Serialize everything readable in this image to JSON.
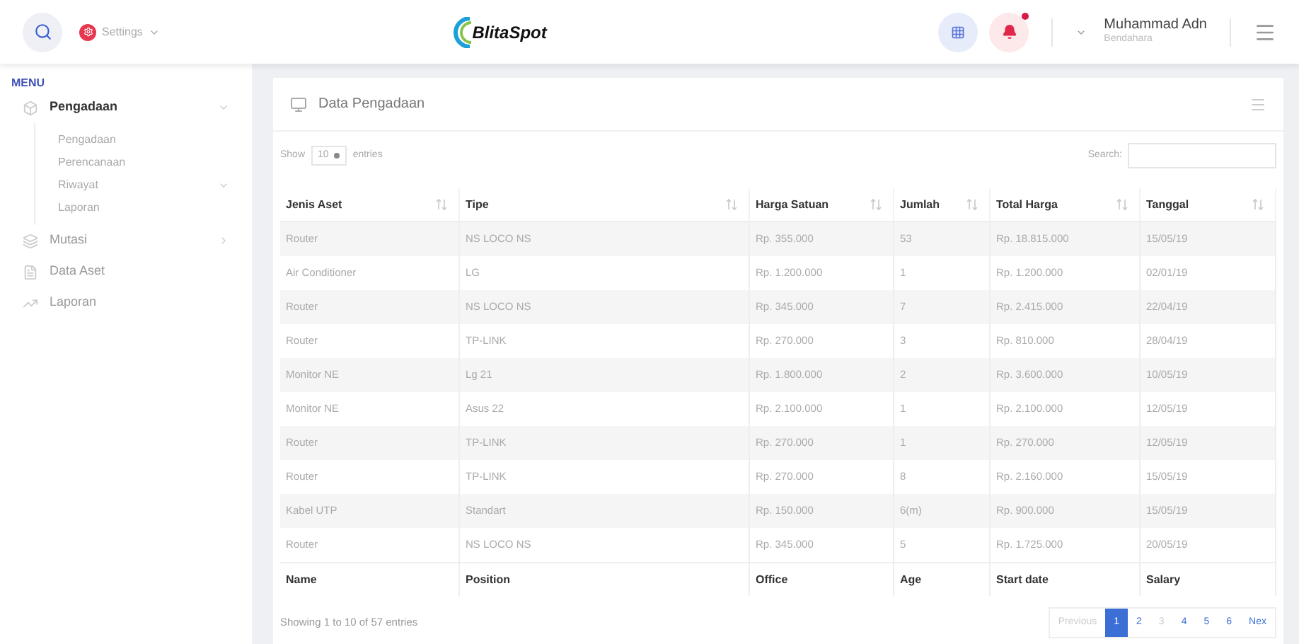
{
  "header": {
    "settings_label": "Settings",
    "logo": "BlitaSpot",
    "user": {
      "name": "Muhammad Adn",
      "role": "Bendahara"
    },
    "notification_dot": true
  },
  "sidebar": {
    "heading": "MENU",
    "items": [
      {
        "label": "Pengadaan",
        "expanded": true,
        "has_chevron": true,
        "children": [
          {
            "label": "Pengadaan",
            "has_chevron": false
          },
          {
            "label": "Perencanaan",
            "has_chevron": false
          },
          {
            "label": "Riwayat",
            "has_chevron": true
          },
          {
            "label": "Laporan",
            "has_chevron": false
          }
        ]
      },
      {
        "label": "Mutasi",
        "expanded": false,
        "has_chevron": true
      },
      {
        "label": "Data Aset",
        "expanded": false,
        "has_chevron": false
      },
      {
        "label": "Laporan",
        "expanded": false,
        "has_chevron": false
      }
    ]
  },
  "card": {
    "title": "Data Pengadaan",
    "show_label": "Show",
    "entries_value": "10",
    "entries_label": "entries",
    "search_label": "Search:",
    "table": {
      "columns": [
        "Jenis Aset",
        "Tipe",
        "Harga Satuan",
        "Jumlah",
        "Total Harga",
        "Tanggal"
      ],
      "rows": [
        [
          "Router",
          "NS LOCO NS",
          "Rp. 355.000",
          "53",
          "Rp. 18.815.000",
          "15/05/19"
        ],
        [
          "Air Conditioner",
          "LG",
          "Rp. 1.200.000",
          "1",
          "Rp. 1.200.000",
          "02/01/19"
        ],
        [
          "Router",
          "NS LOCO NS",
          "Rp. 345.000",
          "7",
          "Rp. 2.415.000",
          "22/04/19"
        ],
        [
          "Router",
          "TP-LINK",
          "Rp. 270.000",
          "3",
          "Rp. 810.000",
          "28/04/19"
        ],
        [
          "Monitor NE",
          "Lg 21",
          "Rp. 1.800.000",
          "2",
          "Rp. 3.600.000",
          "10/05/19"
        ],
        [
          "Monitor NE",
          "Asus 22",
          "Rp. 2.100.000",
          "1",
          "Rp. 2.100.000",
          "12/05/19"
        ],
        [
          "Router",
          "TP-LINK",
          "Rp. 270.000",
          "1",
          "Rp. 270.000",
          "12/05/19"
        ],
        [
          "Router",
          "TP-LINK",
          "Rp. 270.000",
          "8",
          "Rp. 2.160.000",
          "15/05/19"
        ],
        [
          "Kabel UTP",
          "Standart",
          "Rp. 150.000",
          "6(m)",
          "Rp. 900.000",
          "15/05/19"
        ],
        [
          "Router",
          "NS LOCO NS",
          "Rp. 345.000",
          "5",
          "Rp. 1.725.000",
          "20/05/19"
        ]
      ],
      "footer": [
        "Name",
        "Position",
        "Office",
        "Age",
        "Start date",
        "Salary"
      ]
    },
    "info": "Showing 1 to 10 of 57 entries",
    "pagination": [
      {
        "label": "Previous",
        "selected": false,
        "disabled": true
      },
      {
        "label": "1",
        "selected": true,
        "disabled": false
      },
      {
        "label": "2",
        "selected": false,
        "disabled": false
      },
      {
        "label": "3",
        "selected": false,
        "disabled": true
      },
      {
        "label": "4",
        "selected": false,
        "disabled": false
      },
      {
        "label": "5",
        "selected": false,
        "disabled": false
      },
      {
        "label": "6",
        "selected": false,
        "disabled": false
      },
      {
        "label": "Nex",
        "selected": false,
        "disabled": false
      }
    ]
  }
}
